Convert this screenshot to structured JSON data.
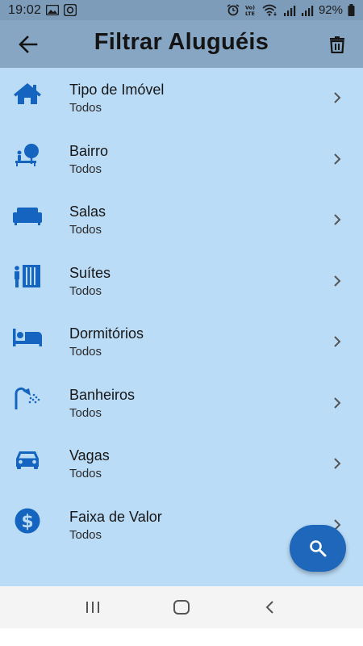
{
  "status_bar": {
    "time": "19:02",
    "battery": "92%",
    "icons": [
      "image-icon",
      "camera-icon",
      "alarm-icon",
      "volte-icon",
      "wifi-icon",
      "signal-icon",
      "signal-icon",
      "battery-icon"
    ]
  },
  "app_bar": {
    "title": "Filtrar Aluguéis",
    "back_icon": "arrow-left-icon",
    "delete_icon": "trash-icon"
  },
  "filters": [
    {
      "label": "Tipo de Imóvel",
      "value": "Todos",
      "icon": "house-icon"
    },
    {
      "label": "Bairro",
      "value": "Todos",
      "icon": "park-icon"
    },
    {
      "label": "Salas",
      "value": "Todos",
      "icon": "sofa-icon"
    },
    {
      "label": "Suítes",
      "value": "Todos",
      "icon": "wardrobe-icon"
    },
    {
      "label": "Dormitórios",
      "value": "Todos",
      "icon": "bed-icon"
    },
    {
      "label": "Banheiros",
      "value": "Todos",
      "icon": "shower-icon"
    },
    {
      "label": "Vagas",
      "value": "Todos",
      "icon": "car-icon"
    },
    {
      "label": "Faixa de Valor",
      "value": "Todos",
      "icon": "dollar-icon"
    }
  ],
  "fab": {
    "icon": "search-icon"
  },
  "nav_bar": {
    "icons": [
      "recents-icon",
      "home-icon",
      "back-icon"
    ]
  },
  "colors": {
    "app_bar": "#86a6c4",
    "status_bar": "#7d9cba",
    "content_bg": "#bbdcf7",
    "icon": "#1565c0",
    "fab": "#1e67bb"
  }
}
